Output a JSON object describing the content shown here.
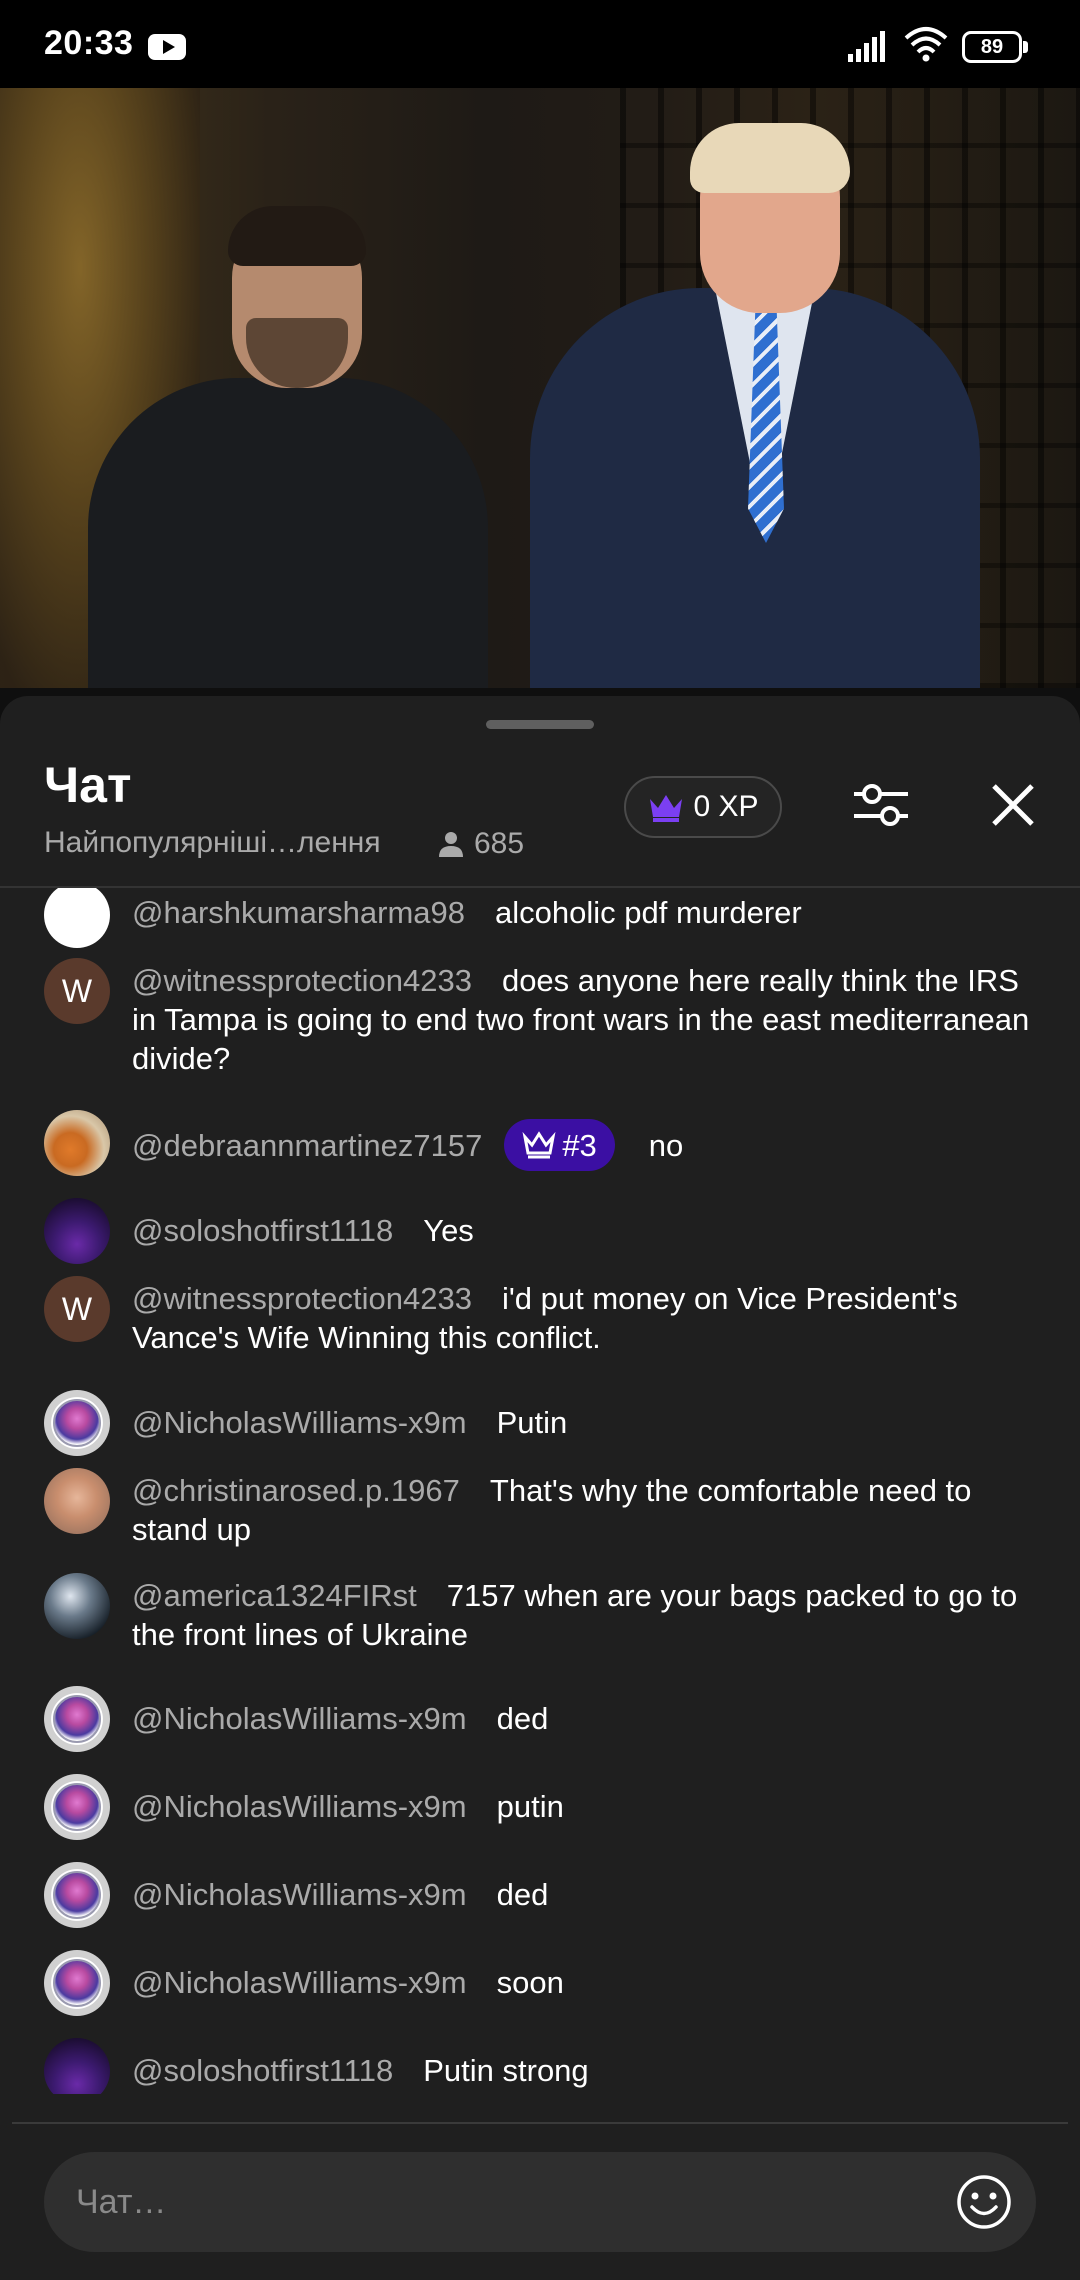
{
  "status_bar": {
    "time": "20:33",
    "battery": "89",
    "icons": [
      "youtube-icon",
      "signal-icon",
      "wifi-icon",
      "battery-icon"
    ]
  },
  "video": {
    "description_icon": "video-player"
  },
  "chat": {
    "title": "Чат",
    "subtitle": "Найпопулярніші…лення",
    "viewer_count": "685",
    "xp_label": "0 XP",
    "input_placeholder": "Чат…",
    "colors": {
      "badge": "#3b0fa3",
      "author": "#aaaaaa",
      "crown": "#7b3ff2"
    },
    "messages": [
      {
        "author": "@harshkumarsharma98",
        "text": "alcoholic pdf murderer",
        "avatar": "white"
      },
      {
        "author": "@witnessprotection4233",
        "text": "does anyone here really think the IRS in Tampa is going to end two front wars in the east mediterranean divide?",
        "avatar": "W"
      },
      {
        "author": "@debraannmartinez7157",
        "badge": "#3",
        "text": "no",
        "avatar": "debra"
      },
      {
        "author": "@soloshotfirst1118",
        "text": "Yes",
        "avatar": "solo"
      },
      {
        "author": "@witnessprotection4233",
        "text": "i'd put money on Vice President's Vance's Wife Winning this conflict.",
        "avatar": "W"
      },
      {
        "author": "@NicholasWilliams-x9m",
        "text": "Putin",
        "avatar": "nick"
      },
      {
        "author": "@christinarosed.p.1967",
        "text": "That's why the comfortable need to stand up",
        "avatar": "christina"
      },
      {
        "author": "@america1324FIRst",
        "text": "7157 when are your bags packed to go to the front lines of Ukraine",
        "avatar": "america"
      },
      {
        "author": "@NicholasWilliams-x9m",
        "text": "ded",
        "avatar": "nick"
      },
      {
        "author": "@NicholasWilliams-x9m",
        "text": "putin",
        "avatar": "nick"
      },
      {
        "author": "@NicholasWilliams-x9m",
        "text": "ded",
        "avatar": "nick"
      },
      {
        "author": "@NicholasWilliams-x9m",
        "text": "soon",
        "avatar": "nick"
      },
      {
        "author": "@soloshotfirst1118",
        "text": "Putin strong",
        "avatar": "solo"
      }
    ]
  }
}
